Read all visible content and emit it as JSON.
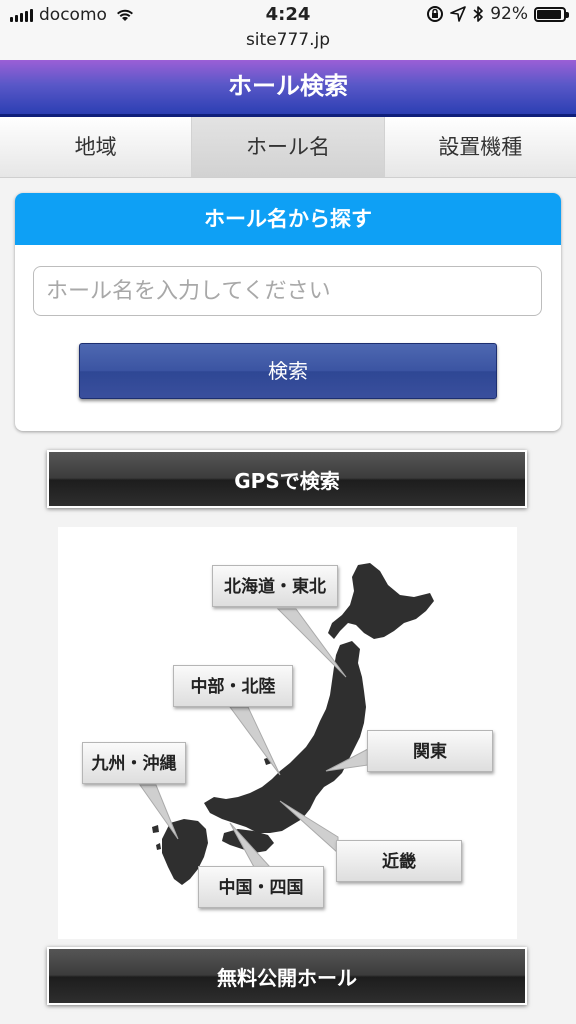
{
  "status_bar": {
    "carrier": "docomo",
    "time": "4:24",
    "battery": "92%",
    "battery_level": 0.92,
    "url": "site777.jp"
  },
  "header": {
    "title": "ホール検索"
  },
  "tabs": [
    {
      "label": "地域",
      "active": false
    },
    {
      "label": "ホール名",
      "active": true
    },
    {
      "label": "設置機種",
      "active": false
    }
  ],
  "search_card": {
    "heading": "ホール名から探す",
    "placeholder": "ホール名を入力してください",
    "button_label": "検索"
  },
  "gps_button": {
    "label": "GPSで検索"
  },
  "map": {
    "regions": [
      {
        "id": "hokkaido-tohoku",
        "label": "北海道・東北"
      },
      {
        "id": "chubu-hokuriku",
        "label": "中部・北陸"
      },
      {
        "id": "kanto",
        "label": "関東"
      },
      {
        "id": "kyushu-okinawa",
        "label": "九州・沖縄"
      },
      {
        "id": "kinki",
        "label": "近畿"
      },
      {
        "id": "chugoku-shikoku",
        "label": "中国・四国"
      }
    ]
  },
  "free_button": {
    "label": "無料公開ホール"
  },
  "colors": {
    "title_bar": "#5a58c8",
    "card_header": "#0ea0f5",
    "search_button": "#3b54a2",
    "dark_button": "#2e2e2e"
  }
}
